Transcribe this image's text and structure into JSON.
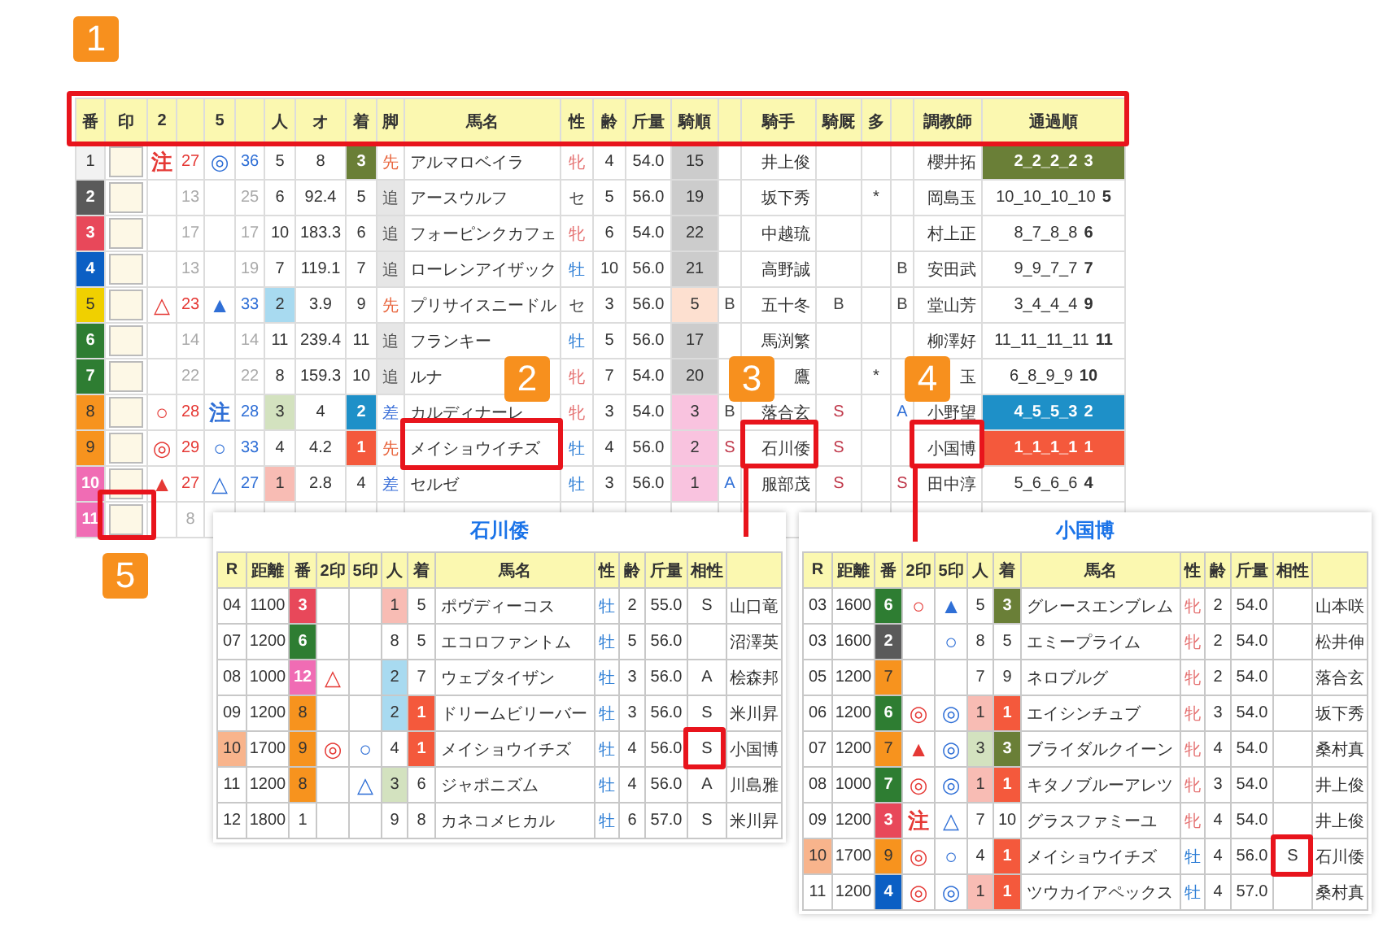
{
  "table": {
    "columns": [
      "番",
      "印",
      "2",
      null,
      "5",
      null,
      "人",
      "オ",
      "着",
      "脚",
      "馬名",
      "性",
      "齢",
      "斤量",
      "騎順",
      null,
      "騎手",
      "騎厩",
      "多",
      null,
      "調教師",
      "通過順"
    ],
    "rows": [
      {
        "no": {
          "text": "1",
          "color": "#f2f2f2"
        },
        "m2": {
          "text": "注",
          "color": "#e53935"
        },
        "v2": {
          "text": "27",
          "color": "#e53935"
        },
        "m5": {
          "text": "◎",
          "color": "#2f6fd6"
        },
        "v5": {
          "text": "36",
          "color": "#2f6fd6"
        },
        "pop": "5",
        "odds": "8",
        "fin": {
          "text": "3",
          "color": "#6a7f37"
        },
        "style": {
          "text": "先",
          "color": "#e8643c"
        },
        "name": "アルマロベイラ",
        "sex": {
          "text": "牝",
          "color": "#e57373"
        },
        "age": "4",
        "wt": "54.0",
        "jo": {
          "text": "15",
          "color": "#cccccc"
        },
        "jockey": "井上俊",
        "trainer": "櫻井拓",
        "pass": {
          "text": "2_2_2_2",
          "last": "3",
          "color": "#6a7f37"
        }
      },
      {
        "no": {
          "text": "2",
          "color": "#5a5a5a"
        },
        "v2": {
          "text": "13",
          "color": "#aaaaaa"
        },
        "v5": {
          "text": "25",
          "color": "#aaaaaa"
        },
        "pop": "6",
        "odds": "92.4",
        "fin": "5",
        "style": {
          "text": "追",
          "color": "#555555",
          "shaded": true
        },
        "name": "アースウルフ",
        "sex": {
          "text": "セ",
          "color": "#444444"
        },
        "age": "5",
        "wt": "56.0",
        "jo": {
          "text": "19",
          "color": "#cccccc"
        },
        "jockey": "坂下秀",
        "multi": "*",
        "trainer": "岡島玉",
        "pass": {
          "text": "10_10_10_10",
          "last": "5"
        }
      },
      {
        "no": {
          "text": "3",
          "color": "#e8485a"
        },
        "v2": {
          "text": "17",
          "color": "#aaaaaa"
        },
        "v5": {
          "text": "17",
          "color": "#aaaaaa"
        },
        "pop": "10",
        "odds": "183.3",
        "fin": "6",
        "style": {
          "text": "追",
          "color": "#555555",
          "shaded": true
        },
        "name": "フォーピンクカフェ",
        "sex": {
          "text": "牝",
          "color": "#e57373"
        },
        "age": "6",
        "wt": "54.0",
        "jo": {
          "text": "22",
          "color": "#cccccc"
        },
        "jockey": "中越琉",
        "trainer": "村上正",
        "pass": {
          "text": "8_7_8_8",
          "last": "6"
        }
      },
      {
        "no": {
          "text": "4",
          "color": "#0b5fc4"
        },
        "v2": {
          "text": "13",
          "color": "#aaaaaa"
        },
        "v5": {
          "text": "19",
          "color": "#aaaaaa"
        },
        "pop": "7",
        "odds": "119.1",
        "fin": "7",
        "style": {
          "text": "追",
          "color": "#555555",
          "shaded": true
        },
        "name": "ローレンアイザック",
        "sex": {
          "text": "牡",
          "color": "#2f7fd6"
        },
        "age": "10",
        "wt": "56.0",
        "jo": {
          "text": "21",
          "color": "#cccccc"
        },
        "jockey": "高野誠",
        "b2": {
          "text": "B",
          "color": "#444444"
        },
        "trainer": "安田武",
        "pass": {
          "text": "9_9_7_7",
          "last": "7"
        }
      },
      {
        "no": {
          "text": "5",
          "color": "#f0d000"
        },
        "m2": {
          "text": "△",
          "color": "#e53935"
        },
        "v2": {
          "text": "23",
          "color": "#e53935"
        },
        "m5": {
          "text": "▲",
          "color": "#2f6fd6"
        },
        "v5": {
          "text": "33",
          "color": "#2f6fd6"
        },
        "pop": {
          "text": "2",
          "color": "#a8daf0"
        },
        "odds": "3.9",
        "fin": "9",
        "style": {
          "text": "先",
          "color": "#e8643c"
        },
        "name": "プリサイスニードル",
        "sex": {
          "text": "セ",
          "color": "#444444"
        },
        "age": "3",
        "wt": "56.0",
        "jo": {
          "text": "5",
          "color": "#fde0d0"
        },
        "b1": {
          "text": "B",
          "color": "#444444"
        },
        "jockey": "五十冬",
        "kyu": {
          "text": "B",
          "color": "#444444"
        },
        "b2": {
          "text": "B",
          "color": "#444444"
        },
        "trainer": "堂山芳",
        "pass": {
          "text": "3_4_4_4",
          "last": "9"
        }
      },
      {
        "no": {
          "text": "6",
          "color": "#2e7d32"
        },
        "v2": {
          "text": "14",
          "color": "#aaaaaa"
        },
        "v5": {
          "text": "14",
          "color": "#aaaaaa"
        },
        "pop": "11",
        "odds": "239.4",
        "fin": "11",
        "style": {
          "text": "追",
          "color": "#555555",
          "shaded": true
        },
        "name": "フランキー",
        "sex": {
          "text": "牡",
          "color": "#2f7fd6"
        },
        "age": "5",
        "wt": "56.0",
        "jo": {
          "text": "17",
          "color": "#cccccc"
        },
        "jockey": "馬渕繁",
        "trainer": "柳澤好",
        "pass": {
          "text": "11_11_11_11",
          "last": "11"
        }
      },
      {
        "no": {
          "text": "7",
          "color": "#2e7d32"
        },
        "v2": {
          "text": "22",
          "color": "#aaaaaa"
        },
        "v5": {
          "text": "22",
          "color": "#aaaaaa"
        },
        "pop": "8",
        "odds": "159.3",
        "fin": "10",
        "style": {
          "text": "追",
          "color": "#555555",
          "shaded": true
        },
        "name": "ルナ",
        "sex": {
          "text": "牝",
          "color": "#e57373"
        },
        "age": "7",
        "wt": "54.0",
        "jo": {
          "text": "20",
          "color": "#cccccc"
        },
        "jockey": "鷹",
        "multi": "*",
        "trainer": "玉",
        "pass": {
          "text": "6_8_9_9",
          "last": "10"
        }
      },
      {
        "no": {
          "text": "8",
          "color": "#f7931e"
        },
        "m2": {
          "text": "○",
          "color": "#e53935"
        },
        "v2": {
          "text": "28",
          "color": "#e53935"
        },
        "m5": {
          "text": "注",
          "color": "#2f6fd6"
        },
        "v5": {
          "text": "28",
          "color": "#2f6fd6"
        },
        "pop": {
          "text": "3",
          "color": "#d3e2bf"
        },
        "odds": "4",
        "fin": {
          "text": "2",
          "color": "#1e90c8"
        },
        "style": {
          "text": "差",
          "color": "#3a6fd8"
        },
        "name": "カルディナーレ",
        "sex": {
          "text": "牝",
          "color": "#e57373"
        },
        "age": "3",
        "wt": "54.0",
        "jo": {
          "text": "3",
          "color": "#f9c3df"
        },
        "b1": {
          "text": "B",
          "color": "#444444"
        },
        "jockey": "落合玄",
        "kyu": {
          "text": "S",
          "color": "#c0394b"
        },
        "b2": {
          "text": "A",
          "color": "#2f6fd6"
        },
        "trainer": "小野望",
        "pass": {
          "text": "4_5_5_3",
          "last": "2",
          "color": "#1e90c8"
        }
      },
      {
        "no": {
          "text": "9",
          "color": "#f7931e"
        },
        "m2": {
          "text": "◎",
          "color": "#e53935"
        },
        "v2": {
          "text": "29",
          "color": "#e53935"
        },
        "m5": {
          "text": "○",
          "color": "#2f6fd6"
        },
        "v5": {
          "text": "33",
          "color": "#2f6fd6"
        },
        "pop": "4",
        "odds": "4.2",
        "fin": {
          "text": "1",
          "color": "#f4593c"
        },
        "style": {
          "text": "先",
          "color": "#e8643c"
        },
        "name": "メイショウイチズ",
        "sex": {
          "text": "牡",
          "color": "#2f7fd6"
        },
        "age": "4",
        "wt": "56.0",
        "jo": {
          "text": "2",
          "color": "#f9c3df"
        },
        "b1": {
          "text": "S",
          "color": "#c0394b"
        },
        "jockey": "石川倭",
        "kyu": {
          "text": "S",
          "color": "#c0394b"
        },
        "trainer": "小国博",
        "pass": {
          "text": "1_1_1_1",
          "last": "1",
          "color": "#f4593c"
        }
      },
      {
        "no": {
          "text": "10",
          "color": "#f06cb4"
        },
        "m2": {
          "text": "▲",
          "color": "#e53935"
        },
        "v2": {
          "text": "27",
          "color": "#e53935"
        },
        "m5": {
          "text": "△",
          "color": "#2f6fd6"
        },
        "v5": {
          "text": "27",
          "color": "#2f6fd6"
        },
        "pop": {
          "text": "1",
          "color": "#f8bcb4"
        },
        "odds": "2.8",
        "fin": "4",
        "style": {
          "text": "差",
          "color": "#3a6fd8"
        },
        "name": "セルゼ",
        "sex": {
          "text": "牡",
          "color": "#2f7fd6"
        },
        "age": "3",
        "wt": "56.0",
        "jo": {
          "text": "1",
          "color": "#f9c3df"
        },
        "b1": {
          "text": "A",
          "color": "#2f6fd6"
        },
        "jockey": "服部茂",
        "kyu": {
          "text": "S",
          "color": "#c0394b"
        },
        "b2": {
          "text": "S",
          "color": "#c0394b"
        },
        "trainer": "田中淳",
        "pass": {
          "text": "5_6_6_6",
          "last": "4"
        }
      },
      {
        "no": {
          "text": "11",
          "color": "#f06cb4"
        },
        "v2": {
          "text": "8",
          "color": "#aaaaaa"
        }
      }
    ]
  },
  "popups": [
    {
      "title": "石川倭",
      "columns": [
        "R",
        "距離",
        "番",
        "2印",
        "5印",
        "人",
        "着",
        "馬名",
        "性",
        "齢",
        "斤量",
        "相性",
        null
      ],
      "rows": [
        {
          "r": "04",
          "dist": "1100",
          "no": {
            "text": "3",
            "color": "#e8485a"
          },
          "pop": {
            "text": "1",
            "color": "#f8bcb4"
          },
          "fin": "5",
          "name": "ポヴディーコス",
          "sex": {
            "text": "牡",
            "color": "#2f7fd6"
          },
          "age": "2",
          "wt": "55.0",
          "aff": "S",
          "person": "山口竜"
        },
        {
          "r": "07",
          "dist": "1200",
          "no": {
            "text": "6",
            "color": "#2e7d32"
          },
          "pop": "8",
          "fin": "5",
          "name": "エコロファントム",
          "sex": {
            "text": "牡",
            "color": "#2f7fd6"
          },
          "age": "5",
          "wt": "56.0",
          "person": "沼澤英"
        },
        {
          "r": "08",
          "dist": "1000",
          "no": {
            "text": "12",
            "color": "#f06cb4"
          },
          "m2": {
            "text": "△",
            "color": "#e53935"
          },
          "pop": {
            "text": "2",
            "color": "#a8daf0"
          },
          "fin": "7",
          "name": "ウェブタイザン",
          "sex": {
            "text": "牡",
            "color": "#2f7fd6"
          },
          "age": "3",
          "wt": "56.0",
          "aff": "A",
          "person": "桧森邦"
        },
        {
          "r": "09",
          "dist": "1200",
          "no": {
            "text": "8",
            "color": "#f7931e"
          },
          "pop": {
            "text": "2",
            "color": "#a8daf0"
          },
          "fin": {
            "text": "1",
            "color": "#f4593c"
          },
          "name": "ドリームビリーバー",
          "sex": {
            "text": "牡",
            "color": "#2f7fd6"
          },
          "age": "3",
          "wt": "56.0",
          "aff": "S",
          "person": "米川昇"
        },
        {
          "r": {
            "text": "10",
            "color": "#f8b48c"
          },
          "dist": "1700",
          "no": {
            "text": "9",
            "color": "#f7931e"
          },
          "m2": {
            "text": "◎",
            "color": "#e53935"
          },
          "m5": {
            "text": "○",
            "color": "#2f6fd6"
          },
          "pop": "4",
          "fin": {
            "text": "1",
            "color": "#f4593c"
          },
          "name": "メイショウイチズ",
          "sex": {
            "text": "牡",
            "color": "#2f7fd6"
          },
          "age": "4",
          "wt": "56.0",
          "aff": "S",
          "person": "小国博"
        },
        {
          "r": "11",
          "dist": "1200",
          "no": {
            "text": "8",
            "color": "#f7931e"
          },
          "m5": {
            "text": "△",
            "color": "#2f6fd6"
          },
          "pop": {
            "text": "3",
            "color": "#d3e2bf"
          },
          "fin": "6",
          "name": "ジャポニズム",
          "sex": {
            "text": "牡",
            "color": "#2f7fd6"
          },
          "age": "4",
          "wt": "56.0",
          "aff": "A",
          "person": "川島雅"
        },
        {
          "r": "12",
          "dist": "1800",
          "no": "1",
          "pop": "9",
          "fin": "8",
          "name": "カネコメヒカル",
          "sex": {
            "text": "牡",
            "color": "#2f7fd6"
          },
          "age": "6",
          "wt": "57.0",
          "aff": "S",
          "person": "米川昇"
        }
      ]
    },
    {
      "title": "小国博",
      "columns": [
        "R",
        "距離",
        "番",
        "2印",
        "5印",
        "人",
        "着",
        "馬名",
        "性",
        "齢",
        "斤量",
        "相性",
        null
      ],
      "rows": [
        {
          "r": "03",
          "dist": "1600",
          "no": {
            "text": "6",
            "color": "#2e7d32"
          },
          "m2": {
            "text": "○",
            "color": "#e53935"
          },
          "m5": {
            "text": "▲",
            "color": "#2f6fd6"
          },
          "pop": "5",
          "fin": {
            "text": "3",
            "color": "#6a7f37"
          },
          "name": "グレースエンブレム",
          "sex": {
            "text": "牝",
            "color": "#e57373"
          },
          "age": "2",
          "wt": "54.0",
          "person": "山本咲"
        },
        {
          "r": "03",
          "dist": "1600",
          "no": {
            "text": "2",
            "color": "#5a5a5a"
          },
          "m5": {
            "text": "○",
            "color": "#2f6fd6"
          },
          "pop": "8",
          "fin": "5",
          "name": "エミープライム",
          "sex": {
            "text": "牝",
            "color": "#e57373"
          },
          "age": "2",
          "wt": "54.0",
          "person": "松井伸"
        },
        {
          "r": "05",
          "dist": "1200",
          "no": {
            "text": "7",
            "color": "#f7931e"
          },
          "pop": "7",
          "fin": "9",
          "name": "ネロブルグ",
          "sex": {
            "text": "牝",
            "color": "#e57373"
          },
          "age": "2",
          "wt": "54.0",
          "person": "落合玄"
        },
        {
          "r": "06",
          "dist": "1200",
          "no": {
            "text": "6",
            "color": "#2e7d32"
          },
          "m2": {
            "text": "◎",
            "color": "#e53935"
          },
          "m5": {
            "text": "◎",
            "color": "#2f6fd6"
          },
          "pop": {
            "text": "1",
            "color": "#f8bcb4"
          },
          "fin": {
            "text": "1",
            "color": "#f4593c"
          },
          "name": "エイシンチュブ",
          "sex": {
            "text": "牝",
            "color": "#e57373"
          },
          "age": "3",
          "wt": "54.0",
          "person": "坂下秀"
        },
        {
          "r": "07",
          "dist": "1200",
          "no": {
            "text": "7",
            "color": "#f7931e"
          },
          "m2": {
            "text": "▲",
            "color": "#e53935"
          },
          "m5": {
            "text": "◎",
            "color": "#2f6fd6"
          },
          "pop": {
            "text": "3",
            "color": "#d3e2bf"
          },
          "fin": {
            "text": "3",
            "color": "#6a7f37"
          },
          "name": "ブライダルクイーン",
          "sex": {
            "text": "牝",
            "color": "#e57373"
          },
          "age": "4",
          "wt": "54.0",
          "person": "桑村真"
        },
        {
          "r": "08",
          "dist": "1000",
          "no": {
            "text": "7",
            "color": "#2e7d32"
          },
          "m2": {
            "text": "◎",
            "color": "#e53935"
          },
          "m5": {
            "text": "◎",
            "color": "#2f6fd6"
          },
          "pop": {
            "text": "1",
            "color": "#f8bcb4"
          },
          "fin": {
            "text": "1",
            "color": "#f4593c"
          },
          "name": "キタノブルーアレツ",
          "sex": {
            "text": "牝",
            "color": "#e57373"
          },
          "age": "3",
          "wt": "54.0",
          "person": "井上俊"
        },
        {
          "r": "09",
          "dist": "1200",
          "no": {
            "text": "3",
            "color": "#e8485a"
          },
          "m2": {
            "text": "注",
            "color": "#e53935"
          },
          "m5": {
            "text": "△",
            "color": "#2f6fd6"
          },
          "pop": "7",
          "fin": "10",
          "name": "グラスファミーユ",
          "sex": {
            "text": "牝",
            "color": "#e57373"
          },
          "age": "4",
          "wt": "54.0",
          "person": "井上俊"
        },
        {
          "r": {
            "text": "10",
            "color": "#f8b48c"
          },
          "dist": "1700",
          "no": {
            "text": "9",
            "color": "#f7931e"
          },
          "m2": {
            "text": "◎",
            "color": "#e53935"
          },
          "m5": {
            "text": "○",
            "color": "#2f6fd6"
          },
          "pop": "4",
          "fin": {
            "text": "1",
            "color": "#f4593c"
          },
          "name": "メイショウイチズ",
          "sex": {
            "text": "牡",
            "color": "#2f7fd6"
          },
          "age": "4",
          "wt": "56.0",
          "aff": "S",
          "person": "石川倭"
        },
        {
          "r": "11",
          "dist": "1200",
          "no": {
            "text": "4",
            "color": "#0b5fc4"
          },
          "m2": {
            "text": "◎",
            "color": "#e53935"
          },
          "m5": {
            "text": "◎",
            "color": "#2f6fd6"
          },
          "pop": {
            "text": "1",
            "color": "#f8bcb4"
          },
          "fin": {
            "text": "1",
            "color": "#f4593c"
          },
          "name": "ツウカイアペックス",
          "sex": {
            "text": "牡",
            "color": "#2f7fd6"
          },
          "age": "4",
          "wt": "57.0",
          "person": "桑村真"
        }
      ]
    }
  ],
  "callouts": [
    {
      "label": "1"
    },
    {
      "label": "2"
    },
    {
      "label": "3"
    },
    {
      "label": "4"
    },
    {
      "label": "5"
    }
  ]
}
